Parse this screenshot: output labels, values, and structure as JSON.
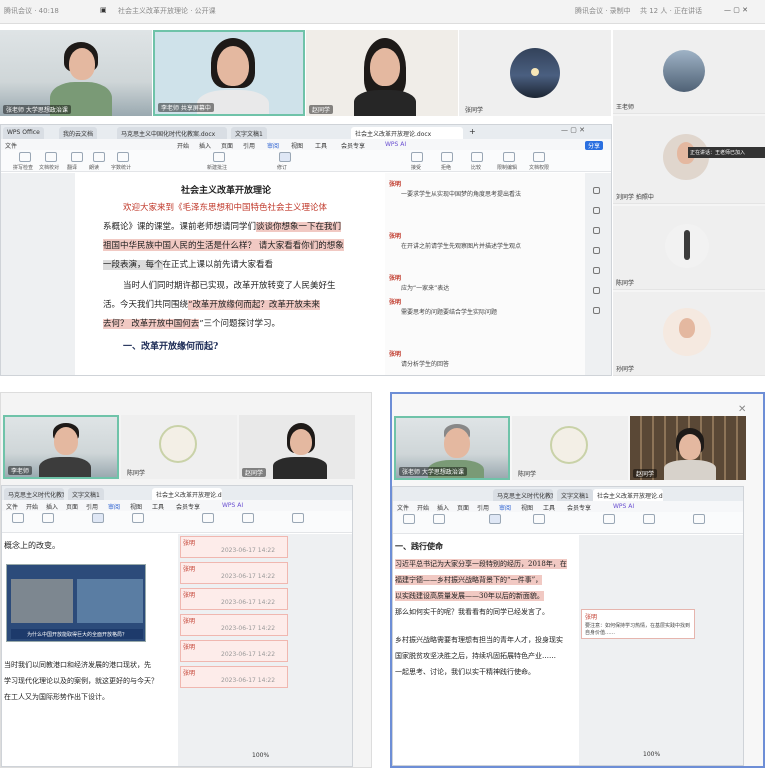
{
  "meeting": {
    "left_info": "腾讯会议  · 40:18",
    "meeting_title": "社会主义改革开放理论 · 公开课",
    "right_info_1": "腾讯会议 · 录制中",
    "right_info_2": "共 12 人 · 正在讲话"
  },
  "video_tiles": {
    "t1": "张老师 大学思想政治课",
    "t2": "李老师 共享屏幕中",
    "t3": "赵同学",
    "t4": "张同学",
    "t5": "王老师",
    "t6": "刘同学 拍照中",
    "t7": "陈同学",
    "t8": "孙同学",
    "t9": "李老师"
  },
  "sidebar_tip": "正在讲话：王老师已加入",
  "main_window": {
    "tabs": [
      "WPS Office",
      "我的云文档",
      "马克思主义中国化时代化教案.docx",
      "文字文稿1",
      "社会主义改革开放理论.docx"
    ],
    "menus": [
      "文件",
      "开始",
      "插入",
      "页面",
      "引用",
      "审阅",
      "视图",
      "工具",
      "会员专享",
      "WPS AI"
    ],
    "ribbon": [
      "拼写检查",
      "文档校对",
      "翻译",
      "朗读",
      "字数统计",
      "新建批注",
      "修订",
      "接受",
      "拒绝",
      "比较",
      "限制编辑",
      "文档权限"
    ],
    "doc_title": "社会主义改革开放理论",
    "para1_a": "欢迎大家来到《毛泽东思想和中国特色社会主义理论体",
    "para1_b": "系概论》课的课堂。课前老师想请同学们",
    "para1_b2": "谈谈你想象一下在我们",
    "para1_c": "祖国中华民族中国人民的生活是什么样？ 请大家看看你们的想象",
    "para1_d": "一段表演，每个",
    "para1_e": "在正式上课以前先请大家看看",
    "para2_a": "当时人们同时期许都已实现，改革开放转变了人民美好生",
    "para2_b": "活。今天我们共同围绕",
    "para2_b2": "“改革开放缘何而起？改革开放未来",
    "para2_c": "去何？ 改革开放中国何去",
    "para2_c2": "”三个问题探讨学习。",
    "section1": "一、改革开放缘何而起?",
    "comments": [
      "一要求学生从实现中国梦的角度思考提出看法",
      "在开讲之前请学生先观察图片并描述学生观点",
      "",
      "应为“一家来”表达",
      "需要思考的问题要结合学生实际问题",
      "请分析学生的回答"
    ],
    "commenter": "张明"
  },
  "bottom_left_window": {
    "tabs": [
      "马克思主义时代化教案.docx",
      "文字文稿1",
      "社会主义改革开放理论.docx"
    ],
    "menus": [
      "文件",
      "开始",
      "插入",
      "页面",
      "引用",
      "审阅",
      "视图",
      "工具",
      "会员专享",
      "WPS AI"
    ],
    "doc_line1": "概念上的改变。",
    "caption": "为什么中国开放能取得巨大的全面开放格局？",
    "para_a": "当时我们以同教港口和经济发展的港口现状，先",
    "para_b": "学习现代化理论以及的案例，就这更好的与今天？",
    "para_c": "在工人又为国际形势作出下设计。",
    "comment_stamp": "2023-06-17 14:22",
    "commenter": "张明"
  },
  "bottom_right_window": {
    "tabs": [
      "马克思主义时代化教案.docx",
      "文字文稿1",
      "社会主义改革开放理论.docx"
    ],
    "menus": [
      "文件",
      "开始",
      "插入",
      "页面",
      "引用",
      "审阅",
      "视图",
      "工具",
      "会员专享",
      "WPS AI"
    ],
    "heading": "一、践行使命",
    "p1": "习近平总书记为大家分享一段特别的经历，2018年，在",
    "p2": "福建宁德——乡村振兴战略背景下的“一件事”，",
    "p3": "以实践建设高质量发展——30年以后的新面貌。",
    "p4": "那么如何实干的呢？我看看有的同学已经发言了。",
    "p5": "乡村振兴战略需要有理想有担当的青年人才，投身现实",
    "p6": "国家脱贫攻坚决胜之后，持续巩固拓展特色产业……",
    "p7": "一起思考、讨论，我们以实干精神践行使命。",
    "comment": "要注意：如何保持学习热情，在基层实践中找到自身价值……",
    "commenter": "张明"
  },
  "zoom": "100%"
}
